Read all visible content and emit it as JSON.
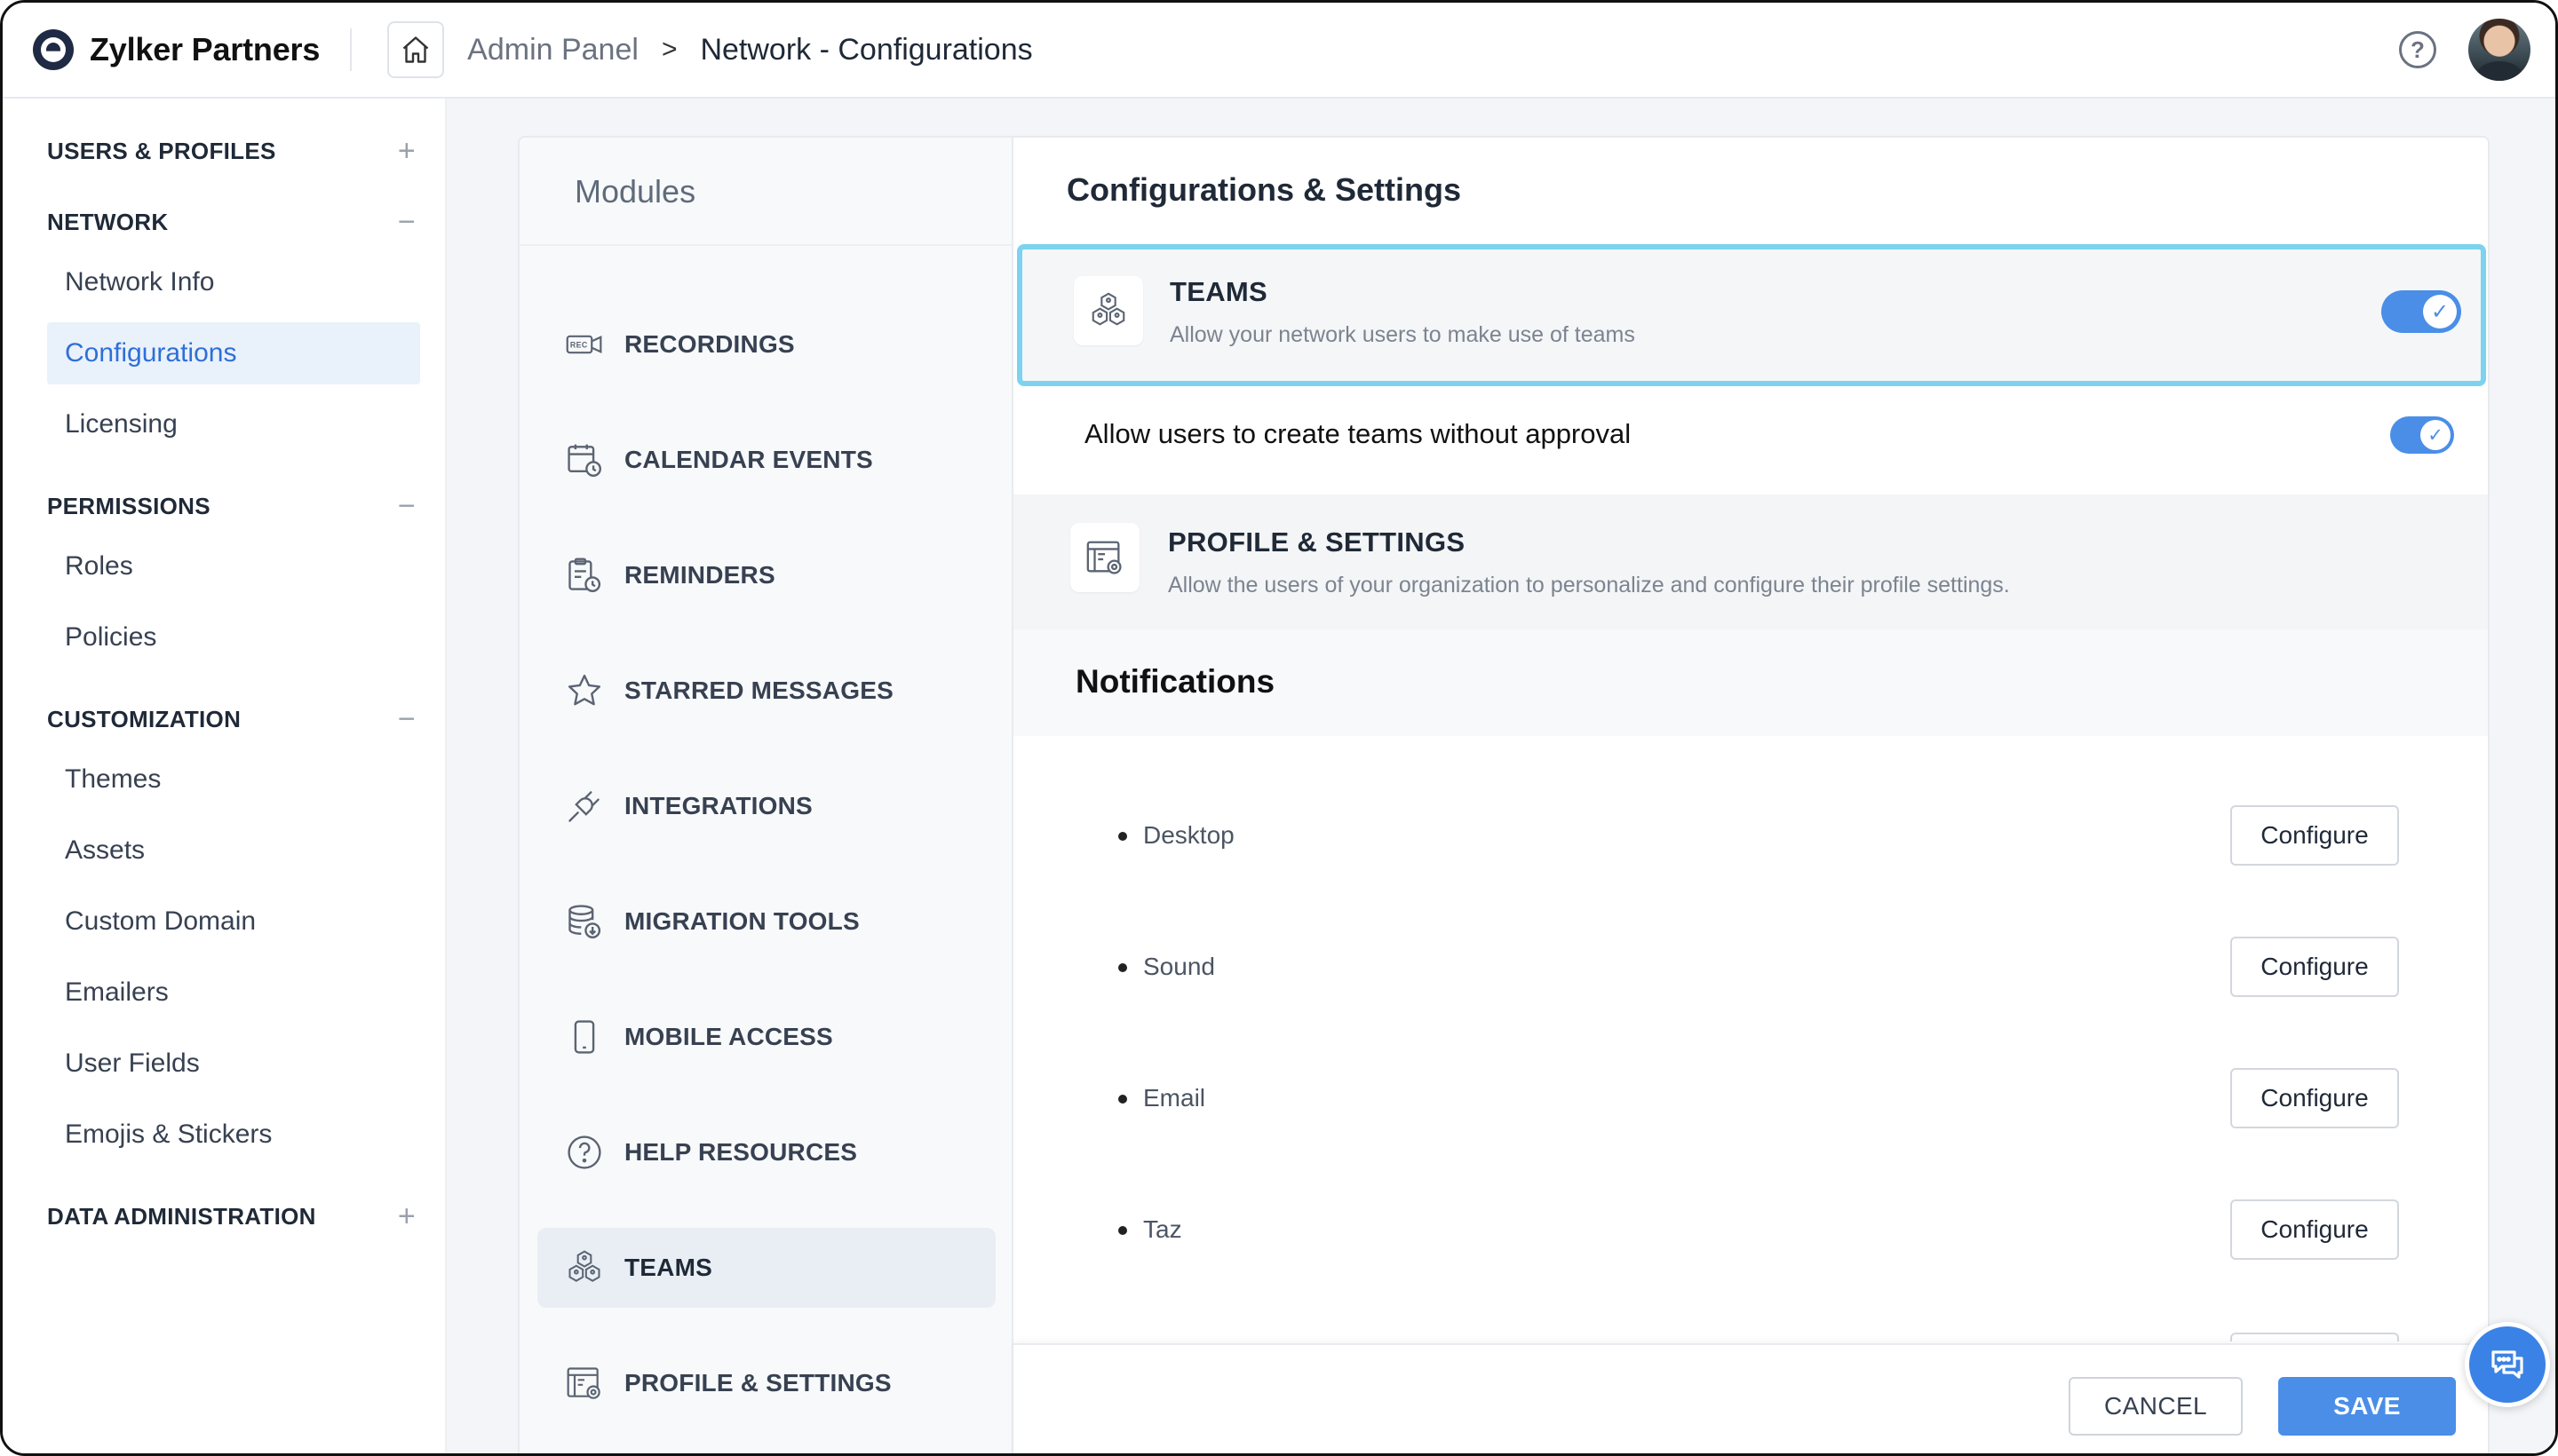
{
  "header": {
    "brand": "Zylker Partners",
    "breadcrumb": {
      "parent": "Admin Panel",
      "separator": ">",
      "current": "Network - Configurations"
    },
    "help_glyph": "?"
  },
  "sidebar": {
    "sections": [
      {
        "title": "USERS & PROFILES",
        "toggle": "+",
        "items": []
      },
      {
        "title": "NETWORK",
        "toggle": "−",
        "items": [
          "Network Info",
          "Configurations",
          "Licensing"
        ],
        "active": "Configurations"
      },
      {
        "title": "PERMISSIONS",
        "toggle": "−",
        "items": [
          "Roles",
          "Policies"
        ]
      },
      {
        "title": "CUSTOMIZATION",
        "toggle": "−",
        "items": [
          "Themes",
          "Assets",
          "Custom Domain",
          "Emailers",
          "User Fields",
          "Emojis & Stickers"
        ]
      },
      {
        "title": "DATA ADMINISTRATION",
        "toggle": "+",
        "items": []
      }
    ]
  },
  "modules": {
    "title": "Modules",
    "items": [
      {
        "label": "RECORDINGS",
        "icon": "recording-icon"
      },
      {
        "label": "CALENDAR EVENTS",
        "icon": "calendar-icon"
      },
      {
        "label": "REMINDERS",
        "icon": "reminder-icon"
      },
      {
        "label": "STARRED MESSAGES",
        "icon": "star-icon"
      },
      {
        "label": "INTEGRATIONS",
        "icon": "plug-icon"
      },
      {
        "label": "MIGRATION TOOLS",
        "icon": "database-icon"
      },
      {
        "label": "MOBILE ACCESS",
        "icon": "mobile-icon"
      },
      {
        "label": "HELP RESOURCES",
        "icon": "help-icon"
      },
      {
        "label": "TEAMS",
        "icon": "teams-icon",
        "active": true
      },
      {
        "label": "PROFILE & SETTINGS",
        "icon": "profile-settings-icon"
      }
    ]
  },
  "settings": {
    "title": "Configurations & Settings",
    "teams": {
      "title": "TEAMS",
      "description": "Allow your network users to make use of teams",
      "enabled": true
    },
    "approval": {
      "label": "Allow users to create teams without approval",
      "enabled": true
    },
    "profile": {
      "title": "PROFILE & SETTINGS",
      "description": "Allow the users of your organization to personalize and configure their profile settings."
    },
    "notifications": {
      "title": "Notifications",
      "items": [
        {
          "label": "Desktop",
          "button": "Configure"
        },
        {
          "label": "Sound",
          "button": "Configure"
        },
        {
          "label": "Email",
          "button": "Configure"
        },
        {
          "label": "Taz",
          "button": "Configure"
        }
      ]
    }
  },
  "footer": {
    "cancel": "CANCEL",
    "save": "SAVE"
  },
  "colors": {
    "accent": "#4a8ee8",
    "highlight_border": "#7dd3ef",
    "active_nav_bg": "#e9f1fb",
    "active_nav_text": "#2f6fd6"
  }
}
